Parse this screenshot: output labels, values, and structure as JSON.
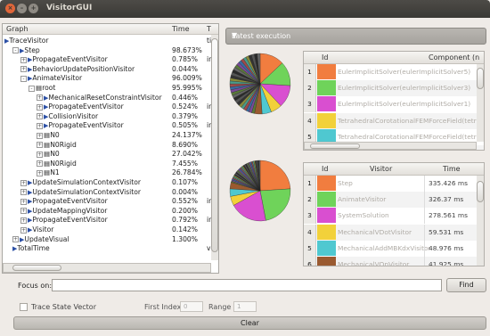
{
  "window": {
    "title": "VisitorGUI"
  },
  "tree": {
    "headers": {
      "graph": "Graph",
      "time": "Time",
      "third": "T"
    },
    "rows": [
      {
        "depth": 0,
        "exp": "",
        "icon": "arrow",
        "name": "TraceVisitor",
        "time": "",
        "extra": "tir"
      },
      {
        "depth": 1,
        "exp": "-",
        "icon": "arrow",
        "name": "Step",
        "time": "98.673%",
        "extra": ""
      },
      {
        "depth": 2,
        "exp": "+",
        "icon": "arrow",
        "name": "PropagateEventVisitor",
        "time": "0.785%",
        "extra": "in"
      },
      {
        "depth": 2,
        "exp": "+",
        "icon": "arrow",
        "name": "BehaviorUpdatePositionVisitor",
        "time": "0.044%",
        "extra": ""
      },
      {
        "depth": 2,
        "exp": "-",
        "icon": "arrow",
        "name": "AnimateVisitor",
        "time": "96.009%",
        "extra": ""
      },
      {
        "depth": 3,
        "exp": "-",
        "icon": "node",
        "name": "root",
        "time": "95.995%",
        "extra": ""
      },
      {
        "depth": 4,
        "exp": "+",
        "icon": "arrow",
        "name": "MechanicalResetConstraintVisitor",
        "time": "0.446%",
        "extra": ""
      },
      {
        "depth": 4,
        "exp": "+",
        "icon": "arrow",
        "name": "PropagateEventVisitor",
        "time": "0.524%",
        "extra": "in"
      },
      {
        "depth": 4,
        "exp": "+",
        "icon": "arrow",
        "name": "CollisionVisitor",
        "time": "0.379%",
        "extra": ""
      },
      {
        "depth": 4,
        "exp": "+",
        "icon": "arrow",
        "name": "PropagateEventVisitor",
        "time": "0.505%",
        "extra": "in"
      },
      {
        "depth": 4,
        "exp": "+",
        "icon": "node",
        "name": "N0",
        "time": "24.137%",
        "extra": ""
      },
      {
        "depth": 4,
        "exp": "+",
        "icon": "node",
        "name": "N0Rigid",
        "time": "8.690%",
        "extra": ""
      },
      {
        "depth": 4,
        "exp": "+",
        "icon": "node",
        "name": "N0",
        "time": "27.042%",
        "extra": ""
      },
      {
        "depth": 4,
        "exp": "+",
        "icon": "node",
        "name": "N0Rigid",
        "time": "7.455%",
        "extra": ""
      },
      {
        "depth": 4,
        "exp": "+",
        "icon": "node",
        "name": "N1",
        "time": "26.784%",
        "extra": ""
      },
      {
        "depth": 2,
        "exp": "+",
        "icon": "arrow",
        "name": "UpdateSimulationContextVisitor",
        "time": "0.107%",
        "extra": ""
      },
      {
        "depth": 2,
        "exp": "+",
        "icon": "arrow",
        "name": "UpdateSimulationContextVisitor",
        "time": "0.004%",
        "extra": ""
      },
      {
        "depth": 2,
        "exp": "+",
        "icon": "arrow",
        "name": "PropagateEventVisitor",
        "time": "0.552%",
        "extra": "in"
      },
      {
        "depth": 2,
        "exp": "+",
        "icon": "arrow",
        "name": "UpdateMappingVisitor",
        "time": "0.200%",
        "extra": ""
      },
      {
        "depth": 2,
        "exp": "+",
        "icon": "arrow",
        "name": "PropagateEventVisitor",
        "time": "0.792%",
        "extra": "in"
      },
      {
        "depth": 2,
        "exp": "+",
        "icon": "arrow",
        "name": "Visitor",
        "time": "0.142%",
        "extra": ""
      },
      {
        "depth": 1,
        "exp": "+",
        "icon": "arrow",
        "name": "UpdateVisual",
        "time": "1.300%",
        "extra": ""
      },
      {
        "depth": 1,
        "exp": "",
        "icon": "arrow",
        "name": "TotalTime",
        "time": "",
        "extra": "va"
      }
    ]
  },
  "latest": {
    "label": "Latest execution"
  },
  "comp_table": {
    "headers": {
      "id": "Id",
      "name": "Component (n"
    },
    "rows": [
      {
        "id": "1",
        "color": "#f17d3f",
        "name": "EulerImplicitSolver(eulerImplicitSolver5)"
      },
      {
        "id": "2",
        "color": "#6fd35a",
        "name": "EulerImplicitSolver(eulerImplicitSolver3)"
      },
      {
        "id": "3",
        "color": "#d94fd0",
        "name": "EulerImplicitSolver(eulerImplicitSolver1)"
      },
      {
        "id": "4",
        "color": "#f2d13a",
        "name": "TetrahedralCorotationalFEMForceField(tetra"
      },
      {
        "id": "5",
        "color": "#4fc8d0",
        "name": "TetrahedralCorotationalFEMForceField(tetra"
      },
      {
        "id": "6",
        "color": "#9a5a30",
        "name": "TetrahedralCorotationalFEMForceField(tetra"
      }
    ]
  },
  "visitor_table": {
    "headers": {
      "id": "Id",
      "name": "Visitor",
      "time": "Time"
    },
    "rows": [
      {
        "id": "1",
        "color": "#f17d3f",
        "name": "Step",
        "time": "335.426 ms"
      },
      {
        "id": "2",
        "color": "#6fd35a",
        "name": "AnimateVisitor",
        "time": "326.37 ms"
      },
      {
        "id": "3",
        "color": "#d94fd0",
        "name": "SystemSolution",
        "time": "278.561 ms"
      },
      {
        "id": "4",
        "color": "#f2d13a",
        "name": "MechanicalVDotVisitor",
        "time": "59.531 ms"
      },
      {
        "id": "5",
        "color": "#4fc8d0",
        "name": "MechanicalAddMBKdxVisitor",
        "time": "48.976 ms"
      },
      {
        "id": "6",
        "color": "#9a5a30",
        "name": "MechanicalVOpVisitor",
        "time": "41.925 ms"
      }
    ]
  },
  "controls": {
    "focus_label": "Focus on:",
    "focus_value": "",
    "find_label": "Find",
    "trace_label": "Trace State Vector",
    "first_index_label": "First Index",
    "first_index_value": "0",
    "range_label": "Range",
    "range_value": "1",
    "clear_label": "Clear"
  },
  "colors": {
    "titlebar": "#3c3b37",
    "accent": "#f17d3f"
  }
}
